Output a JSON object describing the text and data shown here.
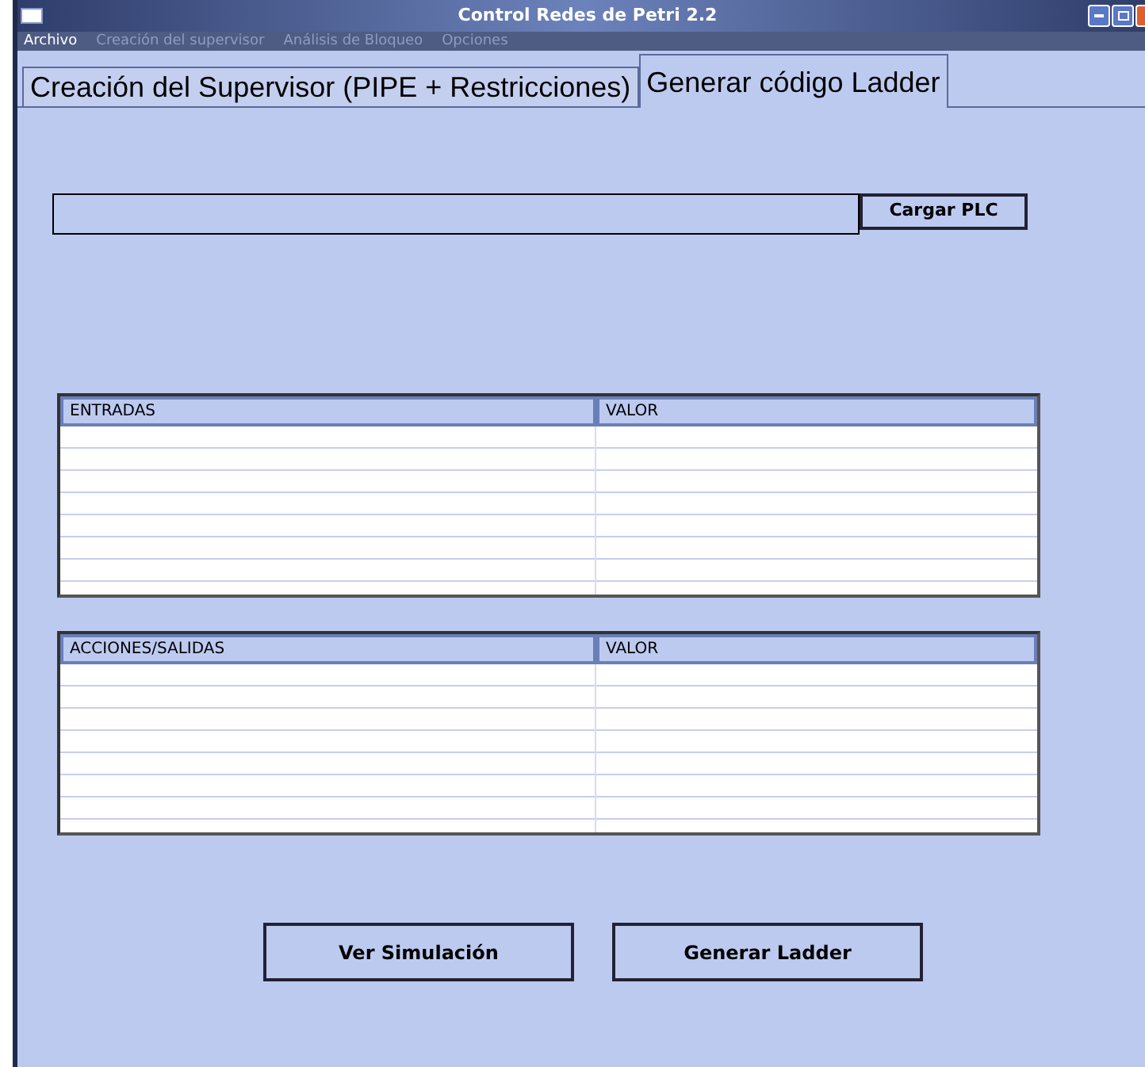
{
  "window": {
    "title": "Control Redes de Petri 2.2"
  },
  "menu": [
    {
      "label": "Archivo",
      "disabled": false
    },
    {
      "label": "Creación del supervisor",
      "disabled": true
    },
    {
      "label": "Análisis de Bloqueo",
      "disabled": true
    },
    {
      "label": "Opciones",
      "disabled": true
    }
  ],
  "tabs": [
    {
      "label": "Creación del Supervisor (PIPE + Restricciones)",
      "selected": false
    },
    {
      "label": "Generar código Ladder",
      "selected": true
    }
  ],
  "plc": {
    "button": "Cargar PLC"
  },
  "tables": [
    {
      "columns": [
        "ENTRADAS",
        "VALOR"
      ]
    },
    {
      "columns": [
        "ACCIONES/SALIDAS",
        "VALOR"
      ]
    }
  ],
  "buttons": [
    "Ver Simulación",
    "Generar Ladder"
  ]
}
